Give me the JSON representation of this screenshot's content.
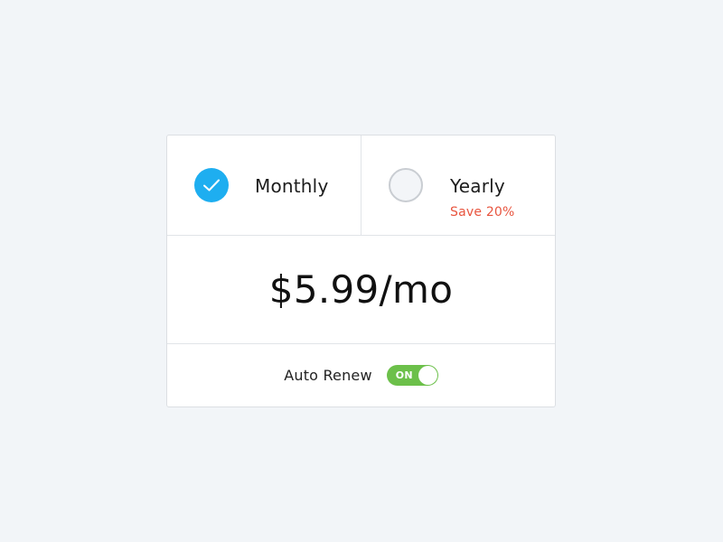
{
  "plans": {
    "monthly": {
      "label": "Monthly",
      "selected": true,
      "icon": "checkmark-icon"
    },
    "yearly": {
      "label": "Yearly",
      "note": "Save 20%",
      "selected": false
    }
  },
  "price": "$5.99/mo",
  "auto_renew": {
    "label": "Auto Renew",
    "toggle_text": "ON",
    "enabled": true
  },
  "colors": {
    "background": "#f2f5f8",
    "accent": "#1eaef0",
    "save_note": "#e8553f",
    "toggle_on": "#6cc04a"
  }
}
